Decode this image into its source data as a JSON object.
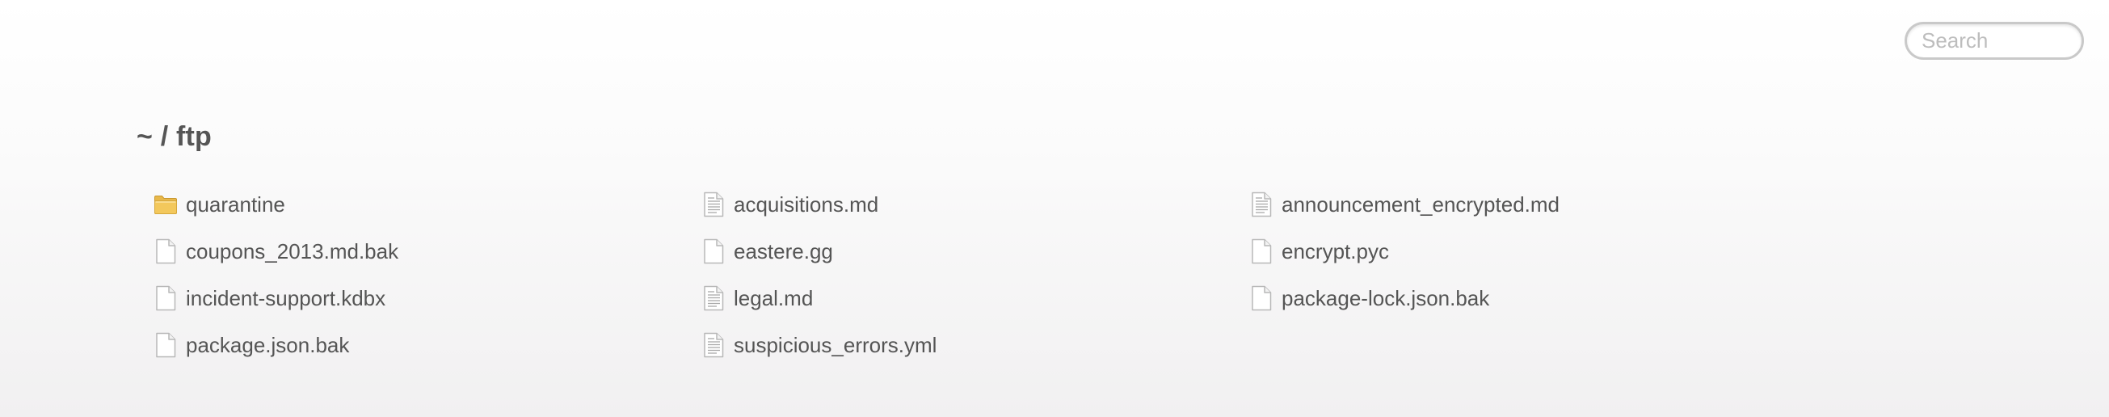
{
  "search": {
    "placeholder": "Search"
  },
  "breadcrumb": {
    "text": "~ / ftp"
  },
  "files": [
    {
      "name": "quarantine",
      "icon": "folder-icon"
    },
    {
      "name": "coupons_2013.md.bak",
      "icon": "blank-file-icon"
    },
    {
      "name": "incident-support.kdbx",
      "icon": "blank-file-icon"
    },
    {
      "name": "package.json.bak",
      "icon": "blank-file-icon"
    },
    {
      "name": "acquisitions.md",
      "icon": "text-file-icon"
    },
    {
      "name": "eastere.gg",
      "icon": "blank-file-icon"
    },
    {
      "name": "legal.md",
      "icon": "text-file-icon"
    },
    {
      "name": "suspicious_errors.yml",
      "icon": "text-file-icon"
    },
    {
      "name": "announcement_encrypted.md",
      "icon": "text-file-icon"
    },
    {
      "name": "encrypt.pyc",
      "icon": "blank-file-icon"
    },
    {
      "name": "package-lock.json.bak",
      "icon": "blank-file-icon"
    }
  ],
  "colors": {
    "text": "#555555",
    "folder": "#f3c85c",
    "file_border": "#b8b8b8"
  }
}
